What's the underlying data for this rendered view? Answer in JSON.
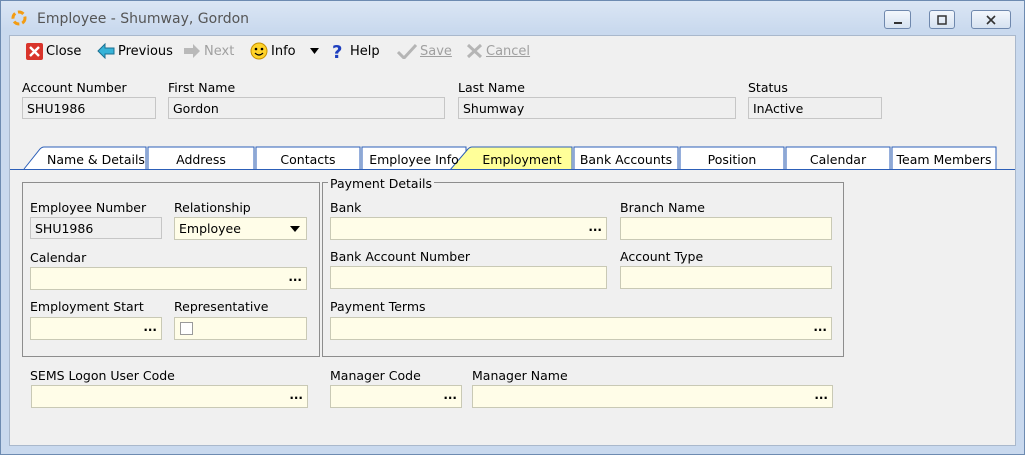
{
  "window": {
    "title": "Employee - Shumway, Gordon",
    "controls": [
      "minimize",
      "restore",
      "close"
    ]
  },
  "toolbar": {
    "close": "Close",
    "previous": "Previous",
    "next": "Next",
    "info": "Info",
    "help": "Help",
    "save": "Save",
    "cancel": "Cancel"
  },
  "header": {
    "account_number_label": "Account Number",
    "account_number": "SHU1986",
    "first_name_label": "First Name",
    "first_name": "Gordon",
    "last_name_label": "Last Name",
    "last_name": "Shumway",
    "status_label": "Status",
    "status": "InActive"
  },
  "tabs": [
    {
      "label": "Name & Details"
    },
    {
      "label": "Address"
    },
    {
      "label": "Contacts"
    },
    {
      "label": "Employee Info"
    },
    {
      "label": "Employment",
      "active": true
    },
    {
      "label": "Bank Accounts"
    },
    {
      "label": "Position"
    },
    {
      "label": "Calendar"
    },
    {
      "label": "Team Members"
    }
  ],
  "employment": {
    "employee_number_label": "Employee Number",
    "employee_number": "SHU1986",
    "relationship_label": "Relationship",
    "relationship": "Employee",
    "calendar_label": "Calendar",
    "calendar": "",
    "employment_start_label": "Employment Start",
    "employment_start": "",
    "representative_label": "Representative",
    "representative_checked": false
  },
  "payment": {
    "group_title": "Payment Details",
    "bank_label": "Bank",
    "bank": "",
    "branch_name_label": "Branch Name",
    "branch_name": "",
    "bank_account_number_label": "Bank Account Number",
    "bank_account_number": "",
    "account_type_label": "Account Type",
    "account_type": "",
    "payment_terms_label": "Payment Terms",
    "payment_terms": ""
  },
  "bottom": {
    "sems_logon_label": "SEMS Logon User Code",
    "sems_logon": "",
    "manager_code_label": "Manager Code",
    "manager_code": "",
    "manager_name_label": "Manager Name",
    "manager_name": ""
  },
  "ellipsis": "...",
  "colors": {
    "input_bg": "#fffde8",
    "active_tab": "#ffff99",
    "tab_border": "#2c5fb8"
  }
}
